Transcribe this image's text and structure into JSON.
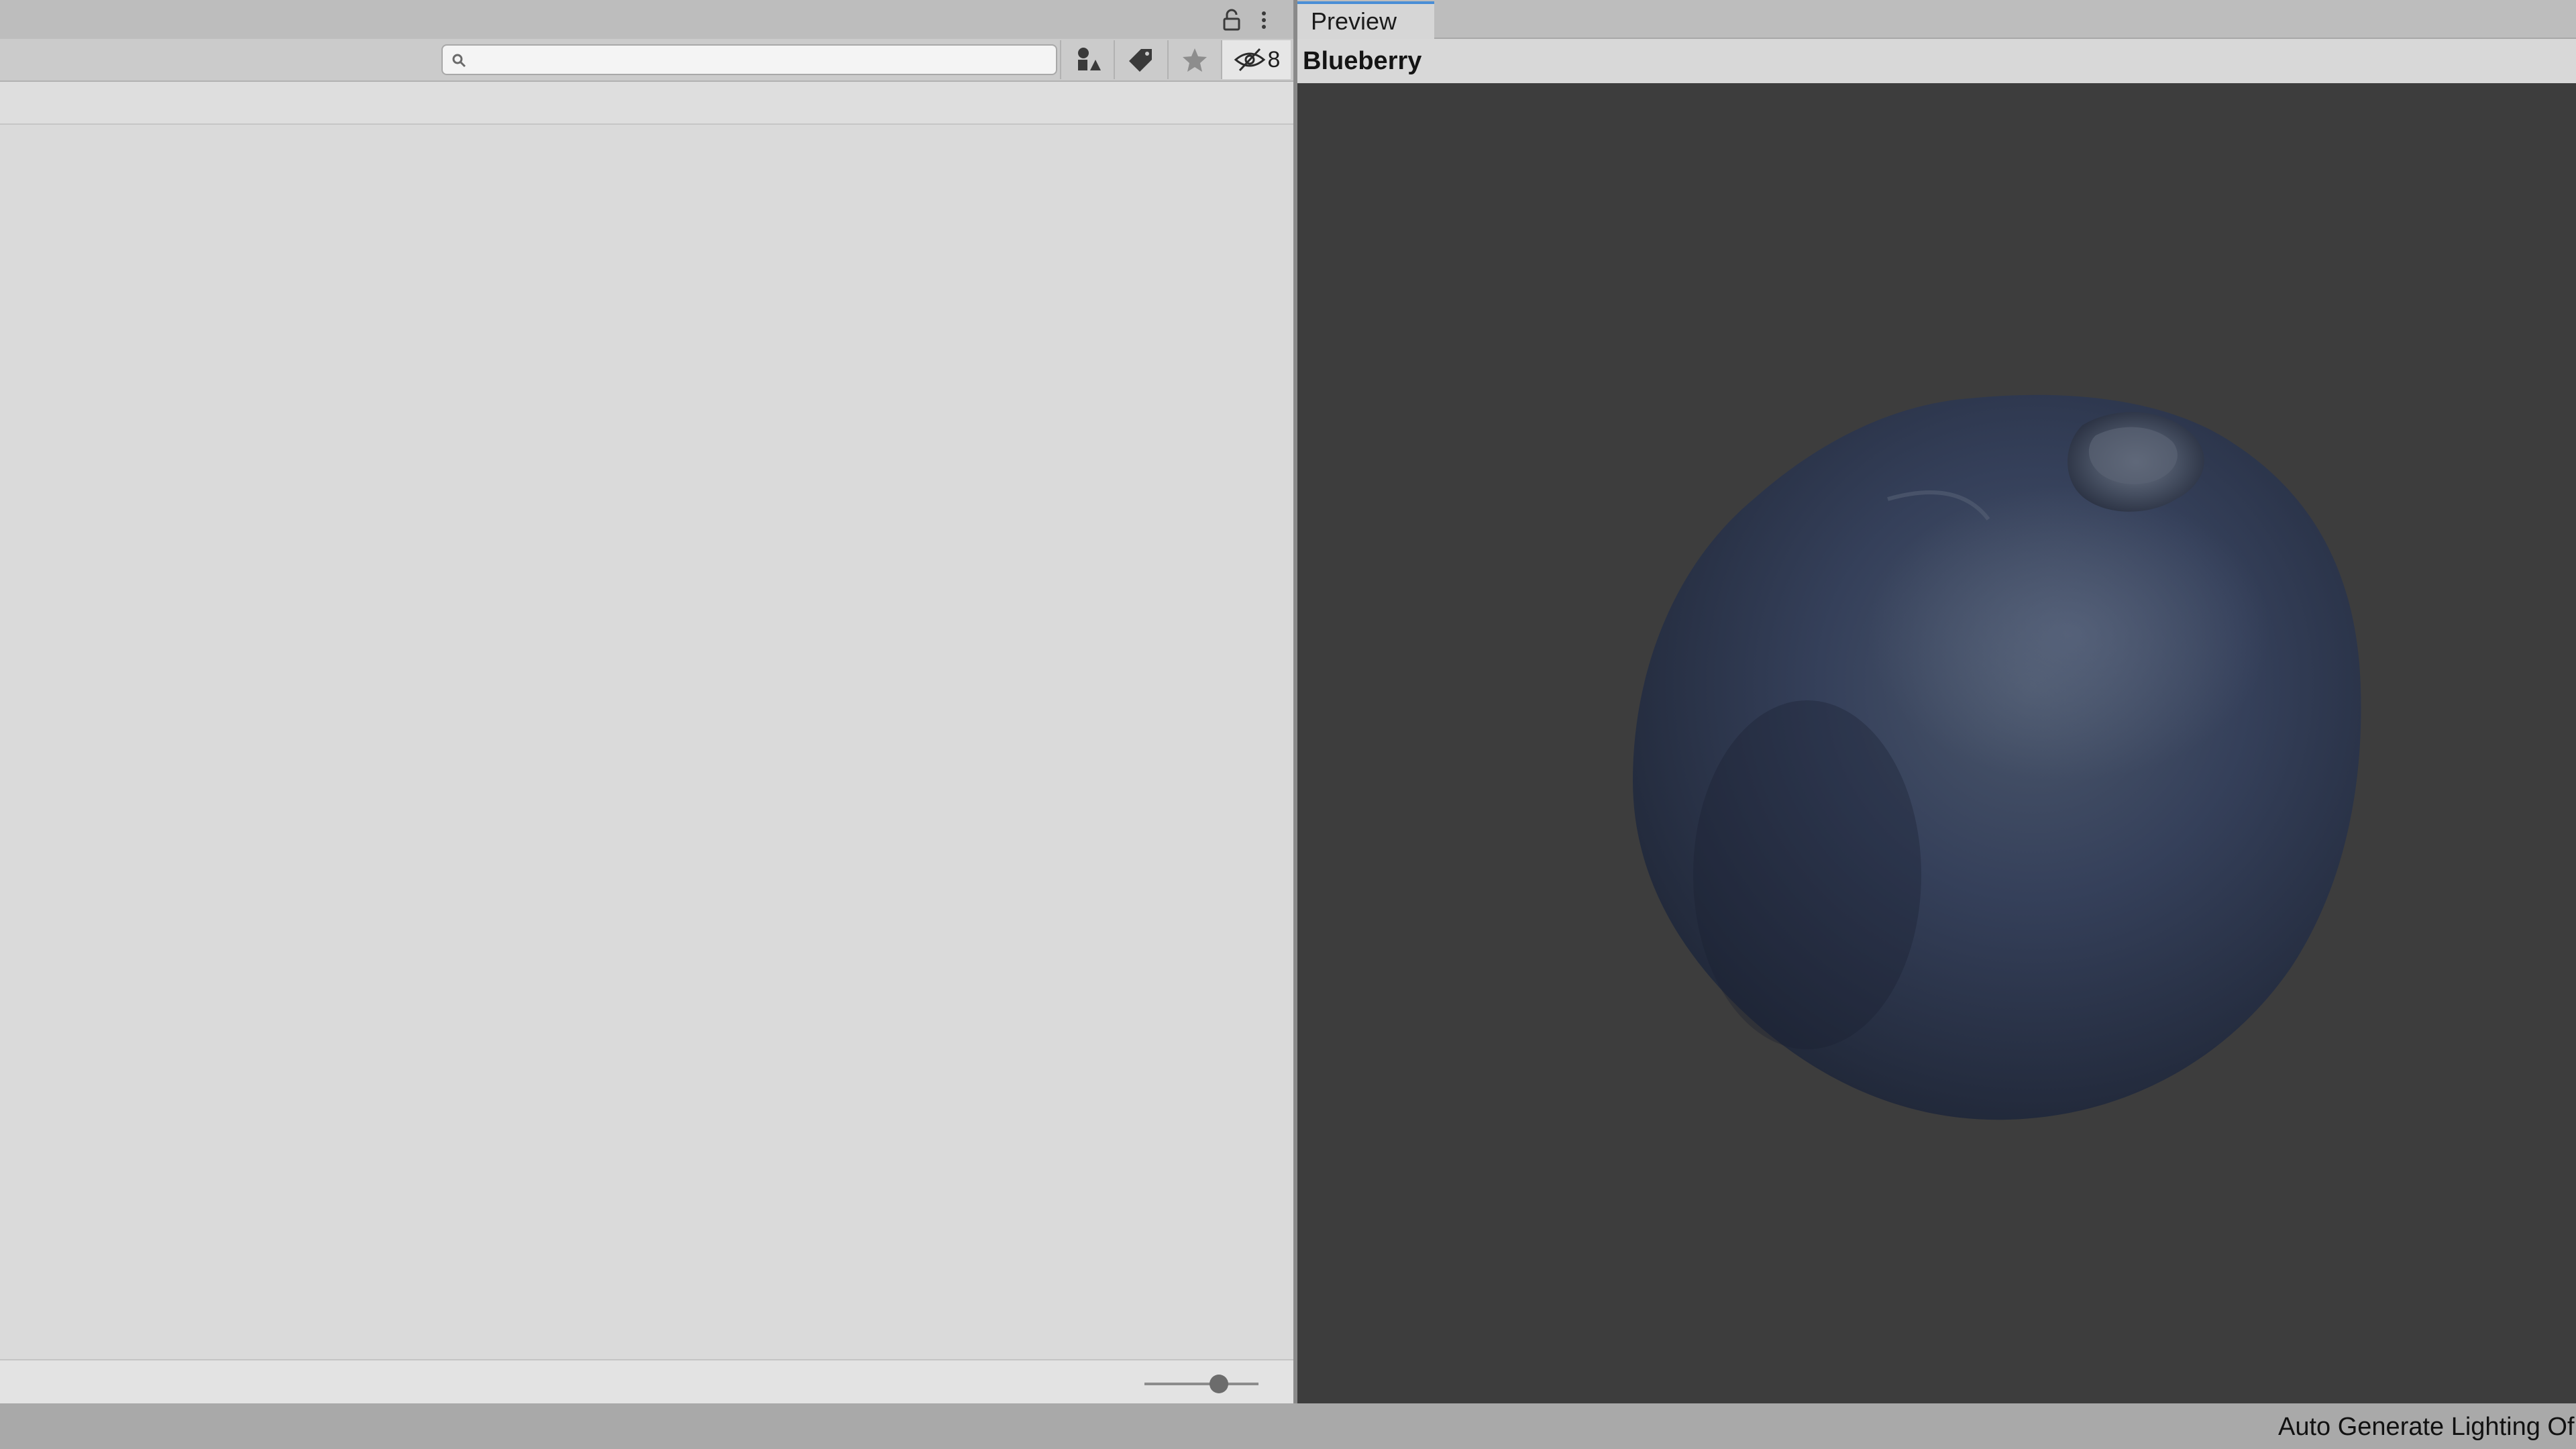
{
  "project_panel": {
    "search": {
      "value": "",
      "placeholder": ""
    },
    "toolbar": {
      "filter_by_type_icon": "shapes-icon",
      "filter_by_label_icon": "tag-icon",
      "favorites_icon": "star-icon",
      "hidden_packages_count": "8"
    },
    "zoom_slider": {
      "value": 0.65
    }
  },
  "preview": {
    "tab_label": "Preview",
    "asset_name": "Blueberry"
  },
  "status_bar": {
    "text": "Auto Generate Lighting Of"
  },
  "colors": {
    "viewport_bg": "#3d3d3d",
    "accent": "#4a8ed6",
    "berry": "#2d3648"
  }
}
